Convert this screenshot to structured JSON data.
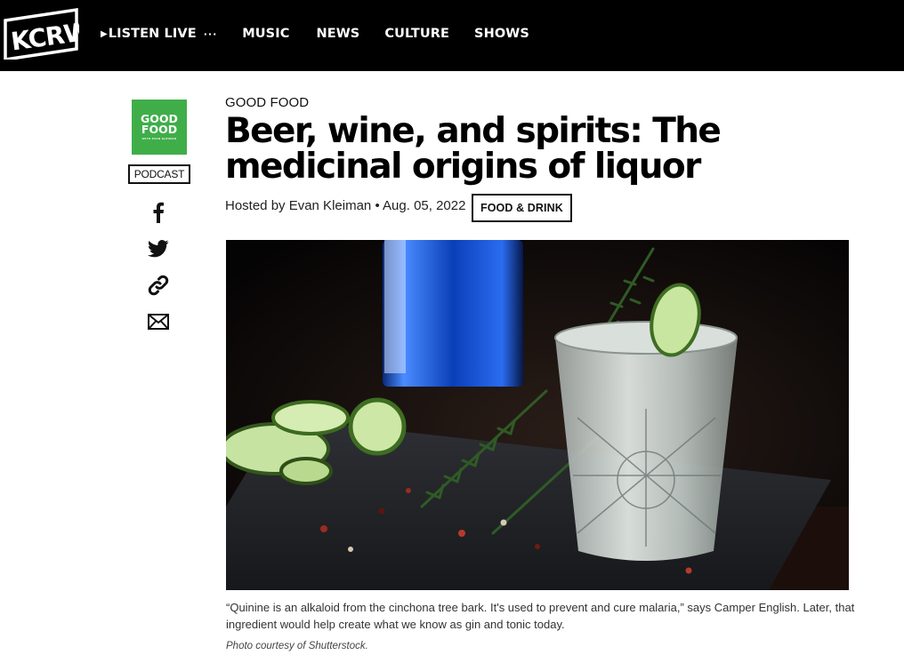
{
  "header": {
    "logo_text": "KCRW",
    "nav": {
      "listen_live": "LISTEN LIVE",
      "music": "MUSIC",
      "news": "NEWS",
      "culture": "CULTURE",
      "shows": "SHOWS"
    }
  },
  "sidebar": {
    "podcast_art": {
      "line1": "GOOD",
      "line2": "FOOD",
      "subtitle": "WITH EVAN KLEIMAN"
    },
    "podcast_label": "PODCAST",
    "share_icons": [
      "facebook-icon",
      "twitter-icon",
      "link-icon",
      "email-icon"
    ]
  },
  "article": {
    "show": "GOOD FOOD",
    "title": "Beer, wine, and spirits: The medicinal origins of liquor",
    "byline": {
      "host": "Hosted by Evan Kleiman",
      "separator": "•",
      "date": "Aug. 05, 2022"
    },
    "tag": "FOOD & DRINK",
    "image": {
      "description_icon": "gin-tonic-photo"
    },
    "caption": "“Quinine is an alkaloid from the cinchona tree bark. It's used to prevent and cure malaria,” says Camper English. Later, that ingredient would help create what we know as gin and tonic today.",
    "credit": "Photo courtesy of Shutterstock."
  },
  "colors": {
    "header_bg": "#000000",
    "podcast_green": "#3fae49",
    "text": "#111111"
  }
}
